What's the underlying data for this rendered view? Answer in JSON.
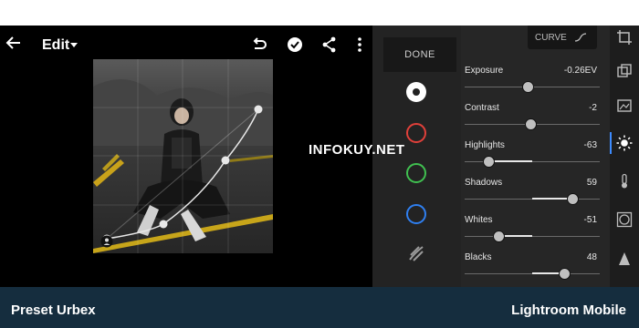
{
  "topbar": {
    "title": "Edit",
    "icons": [
      "back-arrow-icon",
      "caret-down-icon",
      "undo-icon",
      "check-circle-icon",
      "share-icon",
      "more-vert-icon"
    ]
  },
  "tools": {
    "done_label": "DONE",
    "channels": [
      {
        "name": "rgb",
        "color": "#ffffff"
      },
      {
        "name": "red",
        "color": "#e0403a"
      },
      {
        "name": "green",
        "color": "#40c050"
      },
      {
        "name": "blue",
        "color": "#2f7ff0"
      }
    ],
    "split_tone_icon": "split-tone-icon"
  },
  "panel": {
    "curve_label": "CURVE",
    "sliders": [
      {
        "label": "Exposure",
        "value": "-0.26EV",
        "position": 0.47
      },
      {
        "label": "Contrast",
        "value": "-2",
        "position": 0.49
      },
      {
        "label": "Highlights",
        "value": "-63",
        "position": 0.18
      },
      {
        "label": "Shadows",
        "value": "59",
        "position": 0.8
      },
      {
        "label": "Whites",
        "value": "-51",
        "position": 0.25
      },
      {
        "label": "Blacks",
        "value": "48",
        "position": 0.74
      }
    ]
  },
  "rail": {
    "icons": [
      "crop-icon",
      "presets-icon",
      "auto-icon",
      "light-icon",
      "temperature-icon",
      "vignette-icon",
      "detail-icon"
    ],
    "accent": "#3d8bff"
  },
  "watermark": "INFOKUY.NET",
  "footer": {
    "left": "Preset Urbex",
    "right": "Lightroom Mobile",
    "background": "#152d3e"
  }
}
